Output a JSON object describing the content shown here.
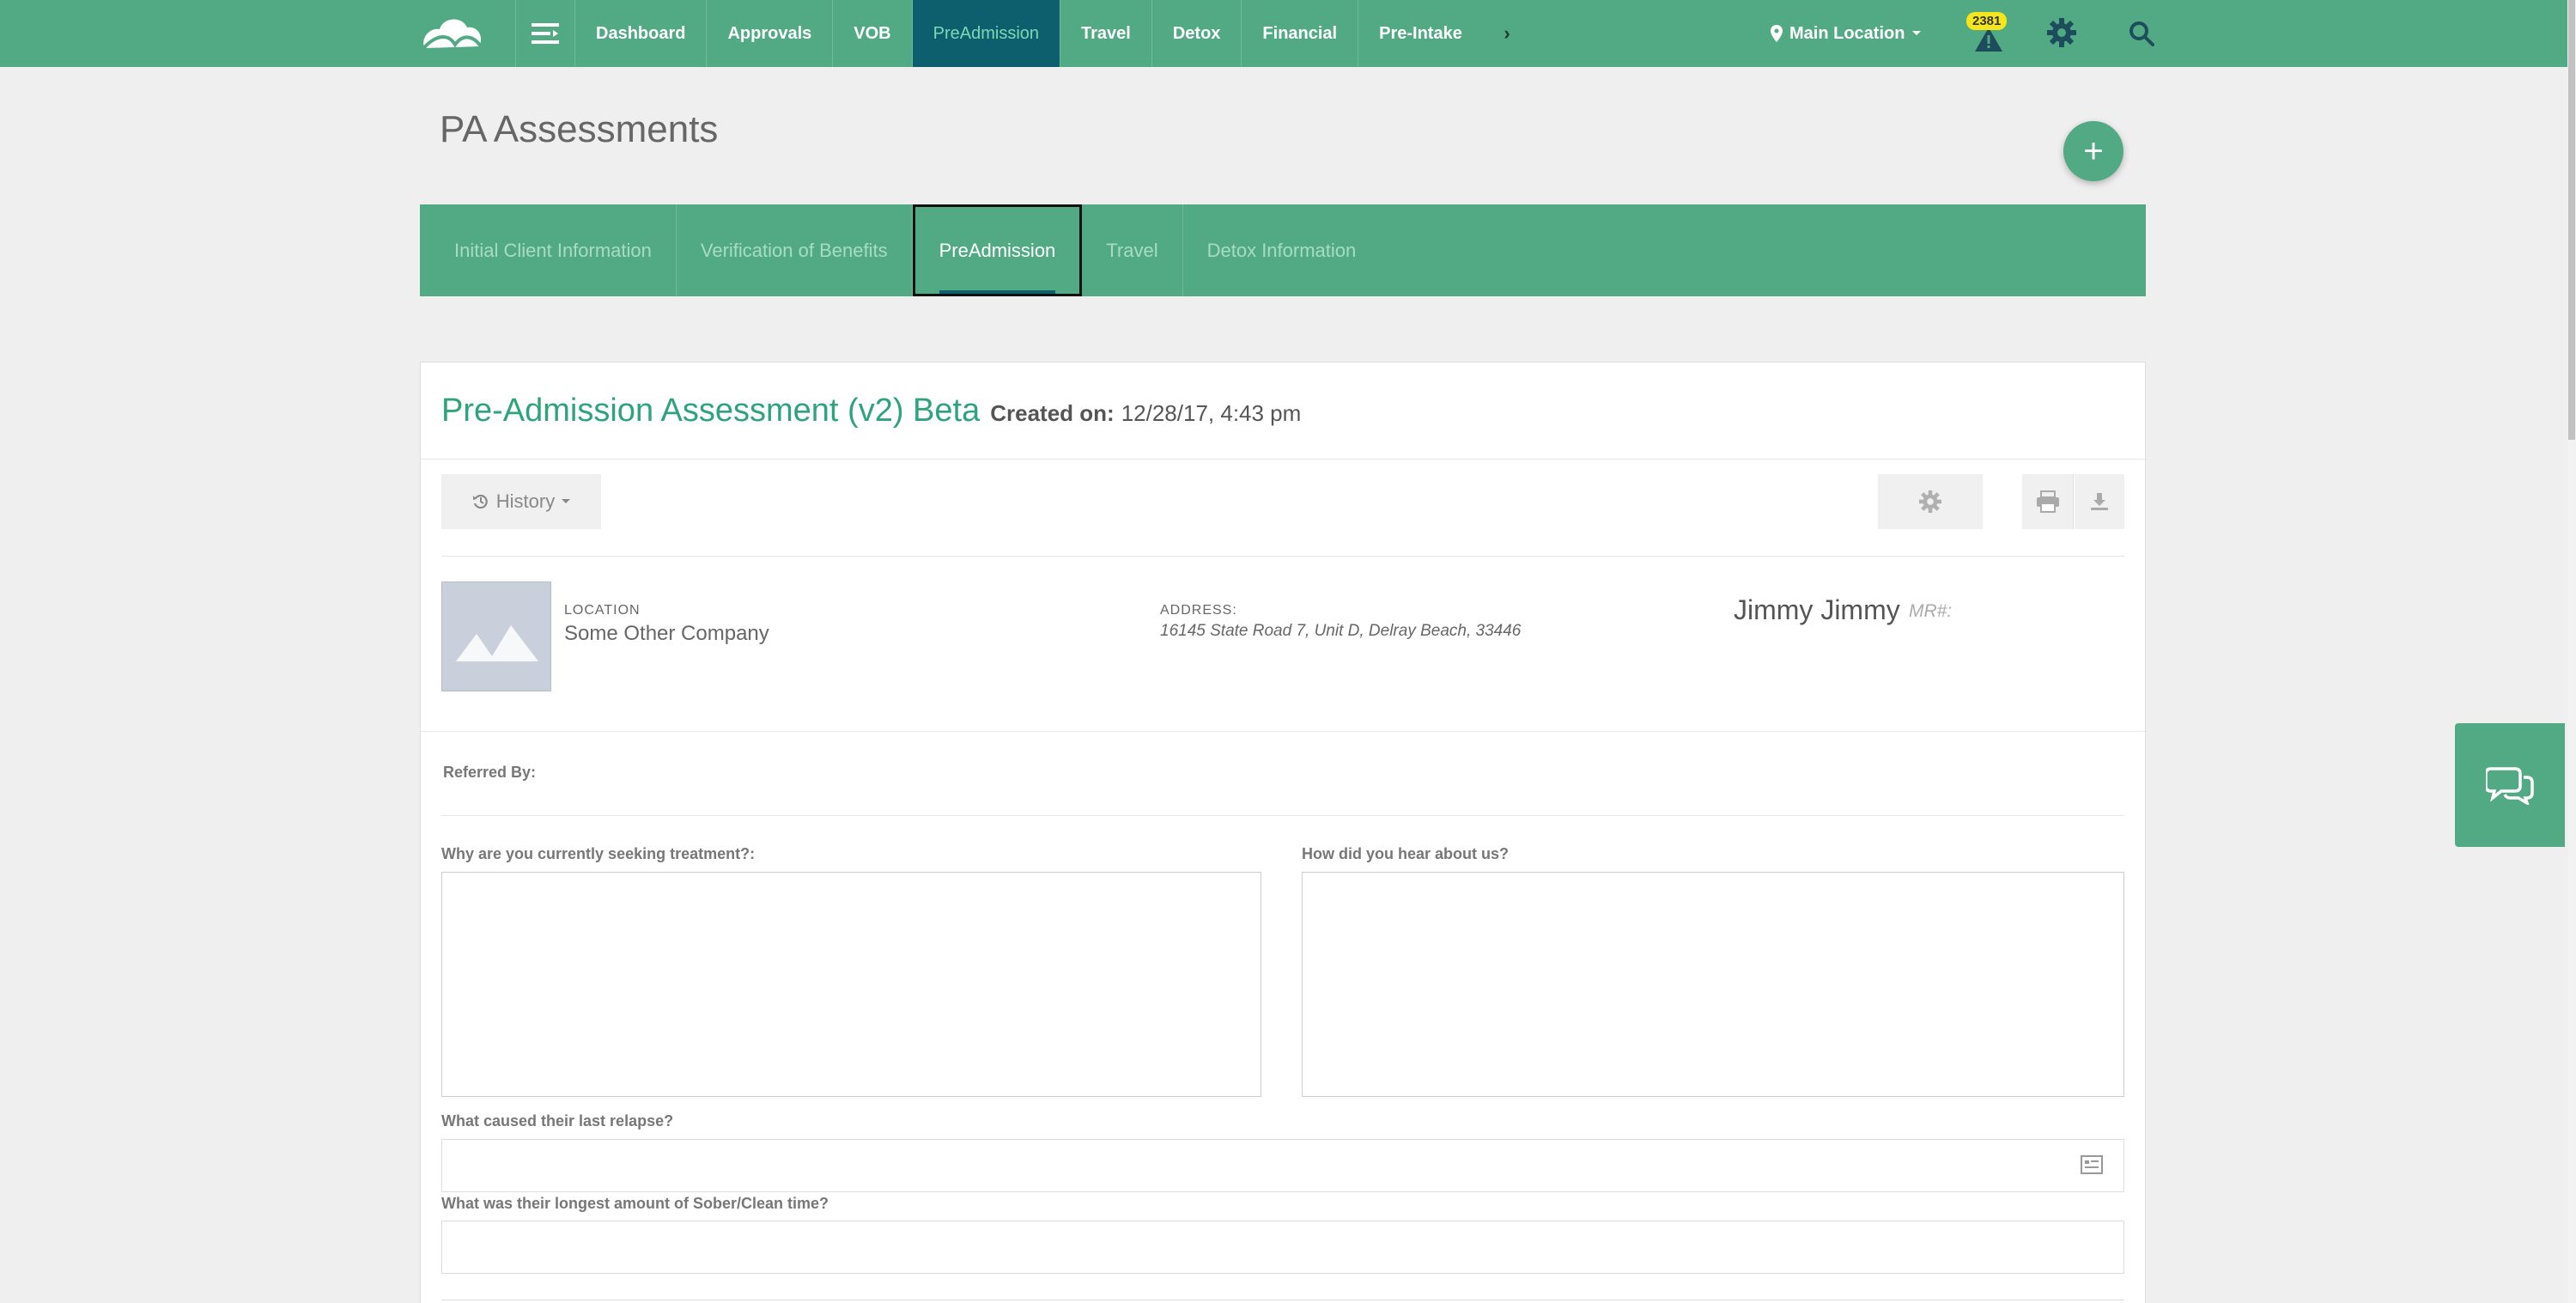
{
  "topnav": {
    "items": [
      {
        "label": "Dashboard"
      },
      {
        "label": "Approvals"
      },
      {
        "label": "VOB"
      },
      {
        "label": "PreAdmission",
        "active": true
      },
      {
        "label": "Travel"
      },
      {
        "label": "Detox"
      },
      {
        "label": "Financial"
      },
      {
        "label": "Pre-Intake"
      }
    ],
    "location_label": "Main Location",
    "alert_count": "2381",
    "colors": {
      "bar": "#52aa84",
      "active": "#0e5f6e",
      "badge": "#f4e61a"
    }
  },
  "page": {
    "title": "PA Assessments"
  },
  "tabs": [
    {
      "label": "Initial Client Information"
    },
    {
      "label": "Verification of Benefits"
    },
    {
      "label": "PreAdmission",
      "active": true
    },
    {
      "label": "Travel"
    },
    {
      "label": "Detox Information"
    }
  ],
  "card": {
    "title": "Pre-Admission Assessment (v2) Beta",
    "created_label": "Created on:",
    "created_value": "12/28/17, 4:43 pm",
    "history_label": "History"
  },
  "header_info": {
    "location_label": "LOCATION",
    "location_value": "Some Other Company",
    "address_label": "ADDRESS:",
    "address_value": "16145 State Road 7, Unit D, Delray Beach, 33446",
    "client_name": "Jimmy Jimmy",
    "mr_label": "MR#:"
  },
  "form": {
    "referred_by_label": "Referred By:",
    "seeking_label": "Why are you currently seeking treatment?:",
    "hear_label": "How did you hear about us?",
    "relapse_label": "What caused their last relapse?",
    "sober_label": "What was their longest amount of Sober/Clean time?",
    "seeking_value": "",
    "hear_value": "",
    "relapse_value": "",
    "sober_value": ""
  }
}
